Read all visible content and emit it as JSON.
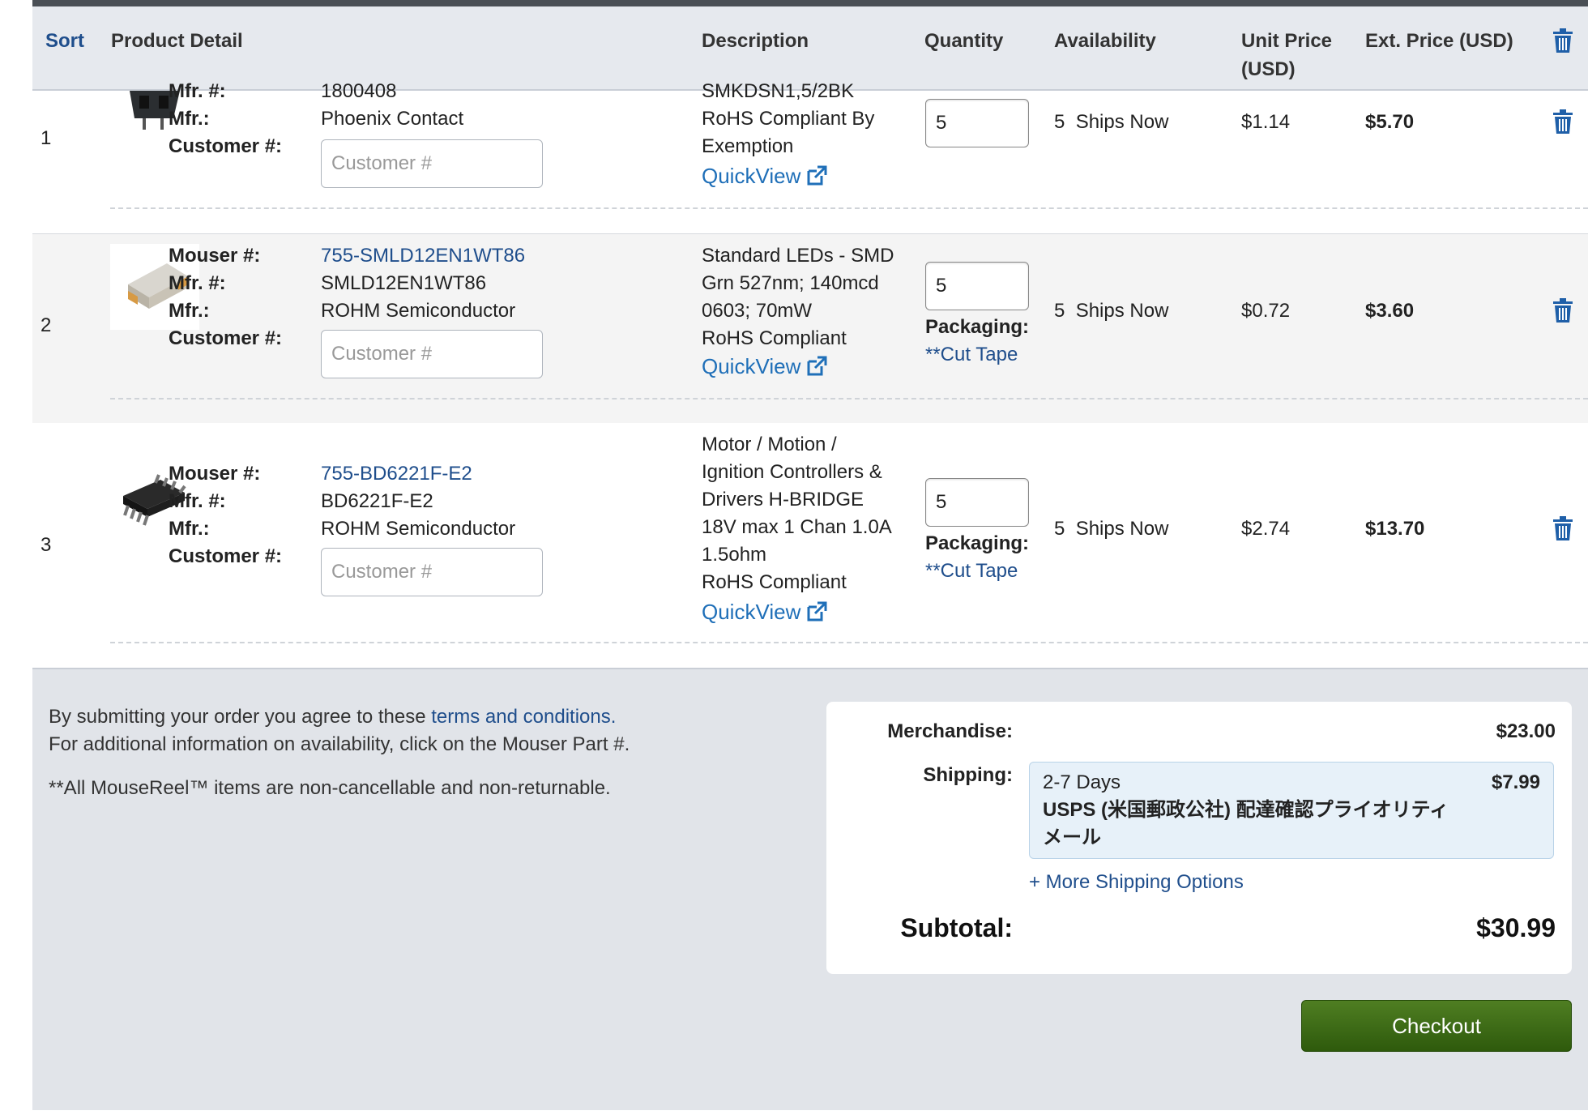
{
  "header": {
    "sort": "Sort",
    "product_detail": "Product Detail",
    "description": "Description",
    "quantity": "Quantity",
    "availability": "Availability",
    "unit_price_line1": "Unit Price",
    "unit_price_line2": "(USD)",
    "ext_price": "Ext. Price (USD)"
  },
  "labels": {
    "mouser": "Mouser #:",
    "mfr_num": "Mfr. #:",
    "mfr": "Mfr.:",
    "customer": "Customer #:",
    "packaging": "Packaging:",
    "quickview": "QuickView"
  },
  "rows": [
    {
      "sort": "1",
      "mfr_num": "1800408",
      "mfr": "Phoenix Contact",
      "customer_placeholder": "Customer #",
      "desc": [
        "SMKDSN1,5/2BK",
        "RoHS Compliant By",
        "Exemption"
      ],
      "qty": "5",
      "avail_count": "5",
      "avail_text": "Ships Now",
      "unit_price": "$1.14",
      "ext_price": "$5.70"
    },
    {
      "sort": "2",
      "mouser": "755-SMLD12EN1WT86",
      "mfr_num": "SMLD12EN1WT86",
      "mfr": "ROHM Semiconductor",
      "customer_placeholder": "Customer #",
      "desc": [
        "Standard LEDs - SMD",
        "Grn 527nm; 140mcd",
        "0603; 70mW",
        "RoHS Compliant"
      ],
      "qty": "5",
      "packaging": "**Cut Tape",
      "avail_count": "5",
      "avail_text": "Ships Now",
      "unit_price": "$0.72",
      "ext_price": "$3.60"
    },
    {
      "sort": "3",
      "mouser": "755-BD6221F-E2",
      "mfr_num": "BD6221F-E2",
      "mfr": "ROHM Semiconductor",
      "customer_placeholder": "Customer #",
      "desc": [
        "Motor / Motion /",
        "Ignition Controllers &",
        "Drivers H-BRIDGE",
        "18V max 1 Chan 1.0A",
        "1.5ohm",
        "RoHS Compliant"
      ],
      "qty": "5",
      "packaging": "**Cut Tape",
      "avail_count": "5",
      "avail_text": "Ships Now",
      "unit_price": "$2.74",
      "ext_price": "$13.70"
    }
  ],
  "footer": {
    "terms_prefix": "By submitting your order you agree to these ",
    "terms_link": "terms and conditions.",
    "availability_note": "For additional information on availability, click on the Mouser Part #.",
    "mousereel_note": "**All MouseReel™ items are non-cancellable and non-returnable."
  },
  "summary": {
    "merchandise_label": "Merchandise:",
    "merchandise_value": "$23.00",
    "shipping_label": "Shipping:",
    "shipping_days": "2-7 Days",
    "shipping_price": "$7.99",
    "shipping_method_line1": "USPS (米国郵政公社) 配達確認プライオリティ",
    "shipping_method_line2": "メール",
    "more_shipping": "+ More Shipping Options",
    "subtotal_label": "Subtotal:",
    "subtotal_value": "$30.99"
  },
  "checkout_label": "Checkout",
  "colors": {
    "link": "#1f4e8c",
    "checkout": "#3d6b16",
    "header_bg": "#e6e9ee"
  },
  "icons": [
    "trash-icon",
    "external-link-icon"
  ]
}
